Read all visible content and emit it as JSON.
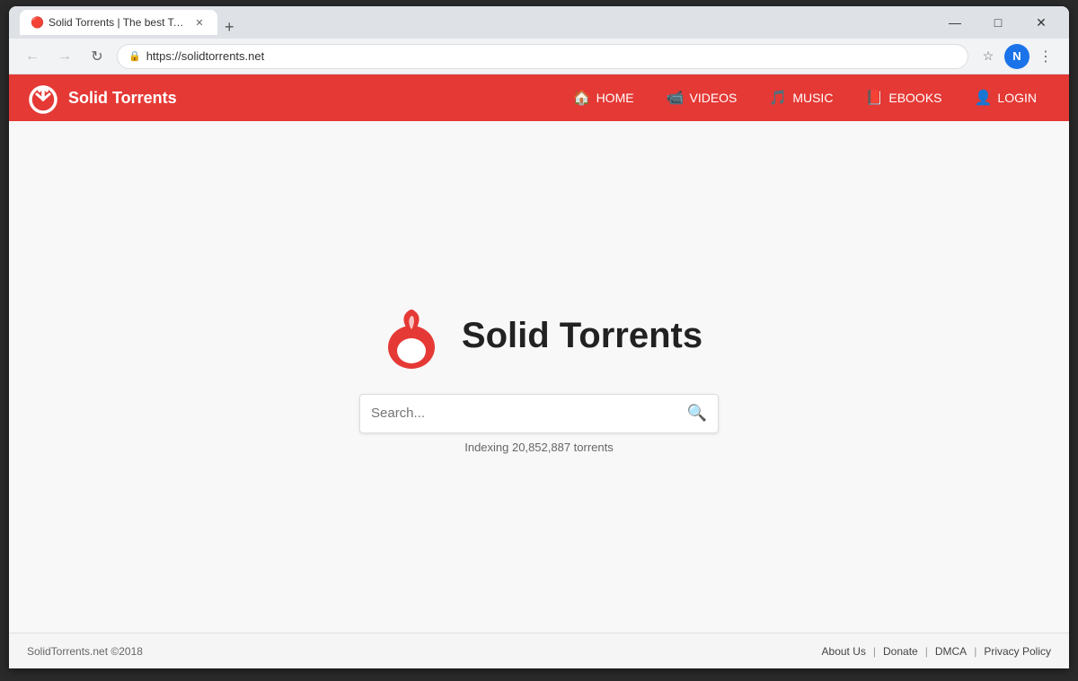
{
  "browser": {
    "tab_title": "Solid Torrents | The best Torrent",
    "tab_favicon": "🔴",
    "url": "https://solidtorrents.net",
    "profile_initial": "N"
  },
  "nav": {
    "logo_text": "Solid Torrents",
    "links": [
      {
        "label": "HOME",
        "icon": "🏠"
      },
      {
        "label": "VIDEOS",
        "icon": "📹"
      },
      {
        "label": "MUSIC",
        "icon": "🎵"
      },
      {
        "label": "EBOOKS",
        "icon": "📕"
      },
      {
        "label": "LOGIN",
        "icon": "👤"
      }
    ]
  },
  "hero": {
    "logo_text": "Solid Torrents",
    "search_placeholder": "Search...",
    "subtitle": "Indexing 20,852,887 torrents"
  },
  "footer": {
    "copyright": "SolidTorrents.net ©2018",
    "links": [
      "About Us",
      "Donate",
      "DMCA",
      "Privacy Policy"
    ]
  }
}
